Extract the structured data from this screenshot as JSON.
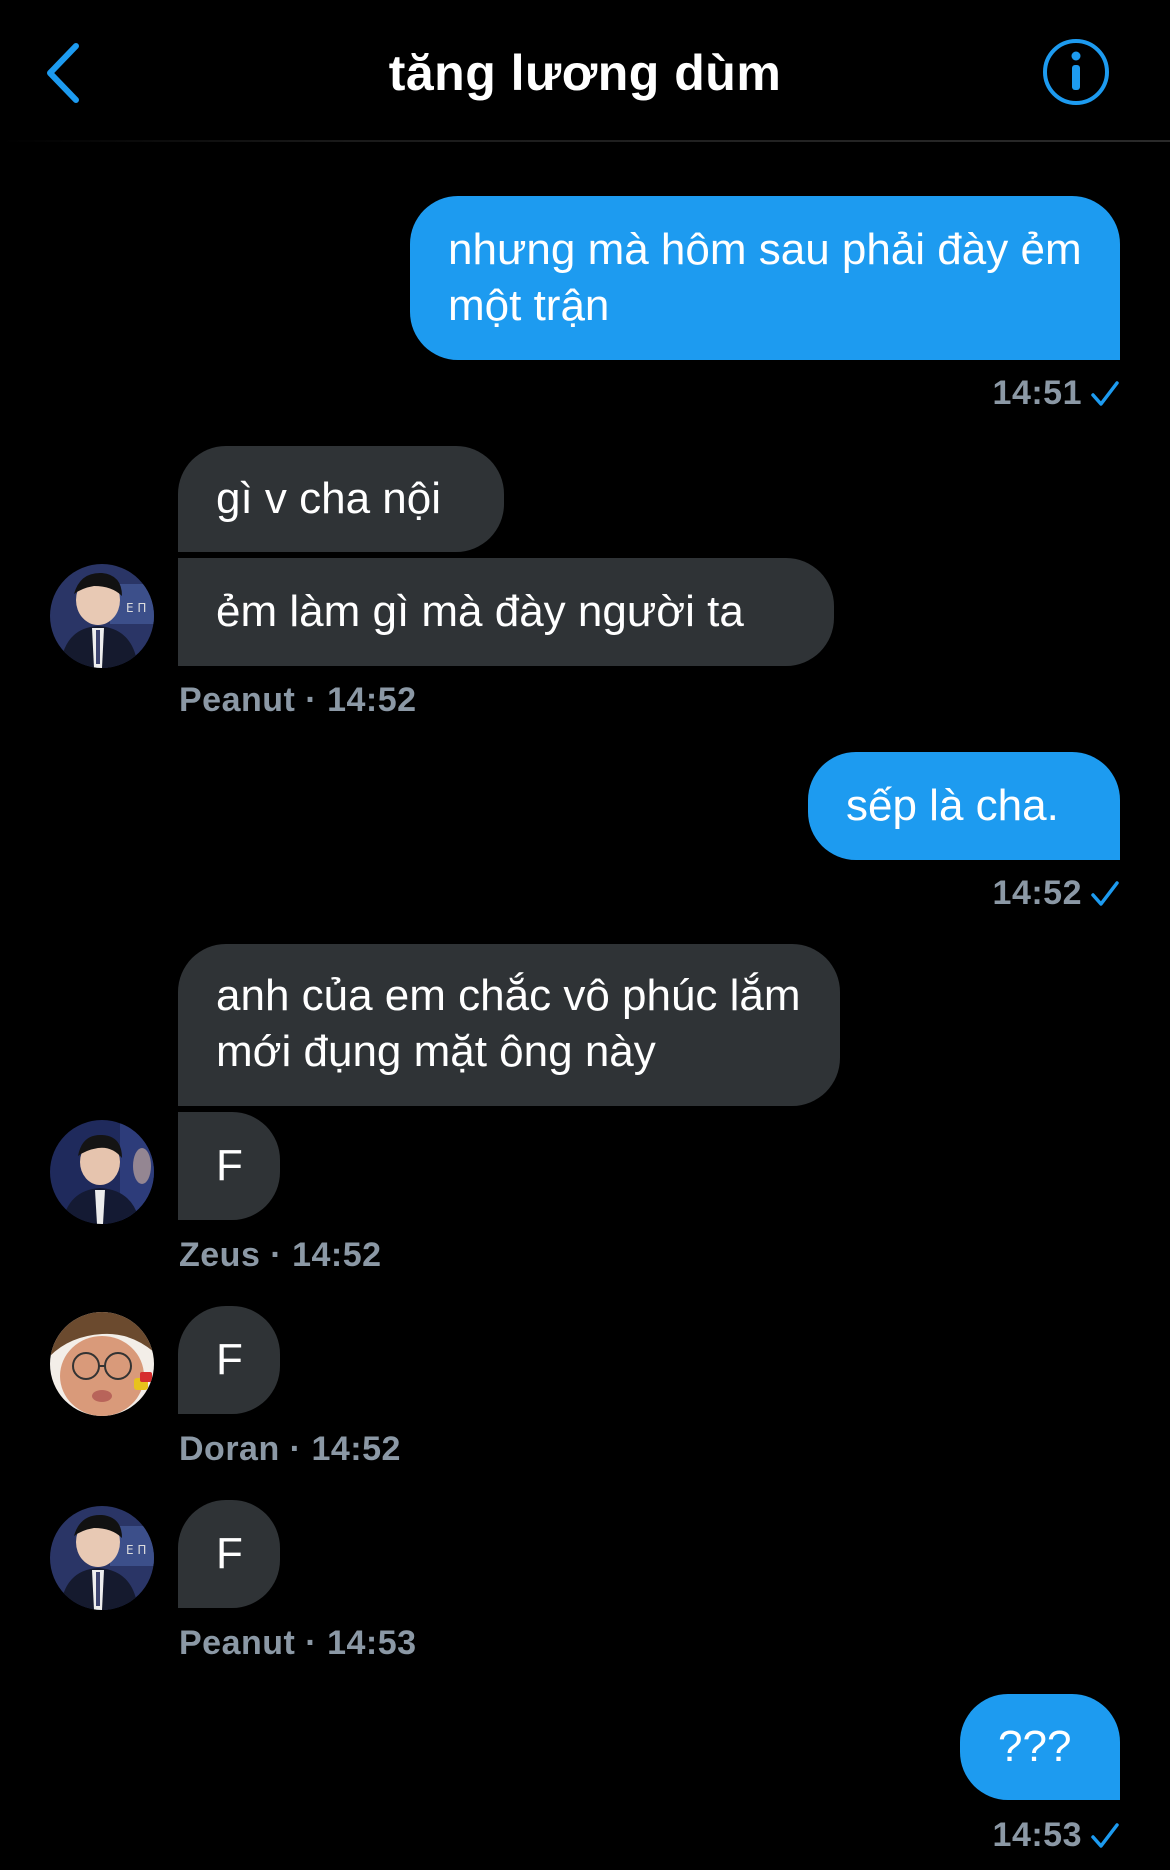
{
  "header": {
    "title": "tăng lương dùm",
    "back_icon": "chevron-left-icon",
    "info_icon": "info-icon",
    "accent": "#1d9bf0"
  },
  "messages": [
    {
      "from": "me",
      "text": "nhưng mà hôm sau phải đày ẻm một trận",
      "time": "14:51"
    },
    {
      "from": "Peanut",
      "text": "gì v cha nội"
    },
    {
      "from": "Peanut",
      "text": "ẻm làm gì mà đày người ta",
      "meta": "Peanut · 14:52"
    },
    {
      "from": "me",
      "text": "sếp là cha.",
      "time": "14:52"
    },
    {
      "from": "Zeus",
      "text": "anh của em chắc vô phúc lắm mới đụng mặt ông này"
    },
    {
      "from": "Zeus",
      "text": "F",
      "meta": "Zeus · 14:52"
    },
    {
      "from": "Doran",
      "text": "F",
      "meta": "Doran · 14:52"
    },
    {
      "from": "Peanut",
      "text": "F",
      "meta": "Peanut · 14:53"
    },
    {
      "from": "me",
      "text": "???",
      "time": "14:53"
    }
  ],
  "colors": {
    "sent_bubble": "#1d9bf0",
    "received_bubble": "#2f3336",
    "meta_text": "#8b98a5",
    "background": "#000000"
  }
}
